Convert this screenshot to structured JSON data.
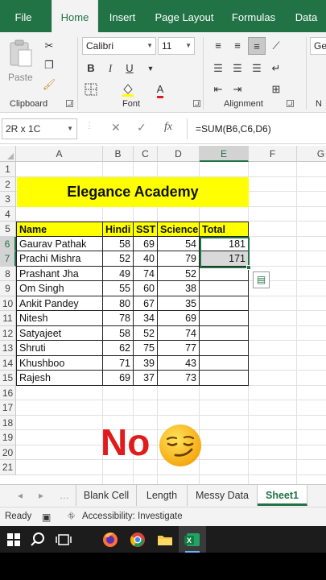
{
  "ribbon_tabs": [
    "File",
    "Home",
    "Insert",
    "Page Layout",
    "Formulas",
    "Data"
  ],
  "active_tab": "Home",
  "ribbon": {
    "paste_label": "Paste",
    "clipboard_label": "Clipboard",
    "font_label": "Font",
    "alignment_label": "Alignment",
    "font_name": "Calibri",
    "font_size": "11",
    "overflow_group_label": "N",
    "number_format_partial": "Ge"
  },
  "formula_bar": {
    "name_box": "2R x 1C",
    "fx_label": "fx",
    "formula": "=SUM(B6,C6,D6)"
  },
  "columns": [
    "A",
    "B",
    "C",
    "D",
    "E",
    "F",
    "G"
  ],
  "rows": [
    "1",
    "2",
    "3",
    "4",
    "5",
    "6",
    "7",
    "8",
    "9",
    "10",
    "11",
    "12",
    "13",
    "14",
    "15",
    "16",
    "17",
    "18",
    "19",
    "20",
    "21"
  ],
  "sheet": {
    "title": "Elegance Academy",
    "headers": [
      "Name",
      "Hindi",
      "SST",
      "Science",
      "Total"
    ],
    "records": [
      [
        "Gaurav Pathak",
        "58",
        "69",
        "54",
        "181"
      ],
      [
        "Prachi Mishra",
        "52",
        "40",
        "79",
        "171"
      ],
      [
        "Prashant Jha",
        "49",
        "74",
        "52",
        ""
      ],
      [
        "Om Singh",
        "55",
        "60",
        "38",
        ""
      ],
      [
        "Ankit Pandey",
        "80",
        "67",
        "35",
        ""
      ],
      [
        "Nitesh",
        "78",
        "34",
        "69",
        ""
      ],
      [
        "Satyajeet",
        "58",
        "52",
        "74",
        ""
      ],
      [
        "Shruti",
        "62",
        "75",
        "77",
        ""
      ],
      [
        "Khushboo",
        "71",
        "39",
        "43",
        ""
      ],
      [
        "Rajesh",
        "69",
        "37",
        "73",
        ""
      ]
    ]
  },
  "overlay": {
    "text": "No",
    "emoji_icon": "smirking-face-emoji",
    "text_color": "#e01b1b"
  },
  "sheet_tabs": [
    "Blank Cell",
    "Length",
    "Messy Data",
    "Sheet1"
  ],
  "active_sheet": "Sheet1",
  "status": {
    "ready": "Ready",
    "accessibility": "Accessibility: Investigate"
  },
  "taskbar_icons": [
    "windows-start-icon",
    "search-icon",
    "task-view-icon",
    "firefox-icon",
    "chrome-icon",
    "file-explorer-icon",
    "excel-icon"
  ],
  "colors": {
    "excel_green": "#217346",
    "highlight_yellow": "#ffff00"
  }
}
